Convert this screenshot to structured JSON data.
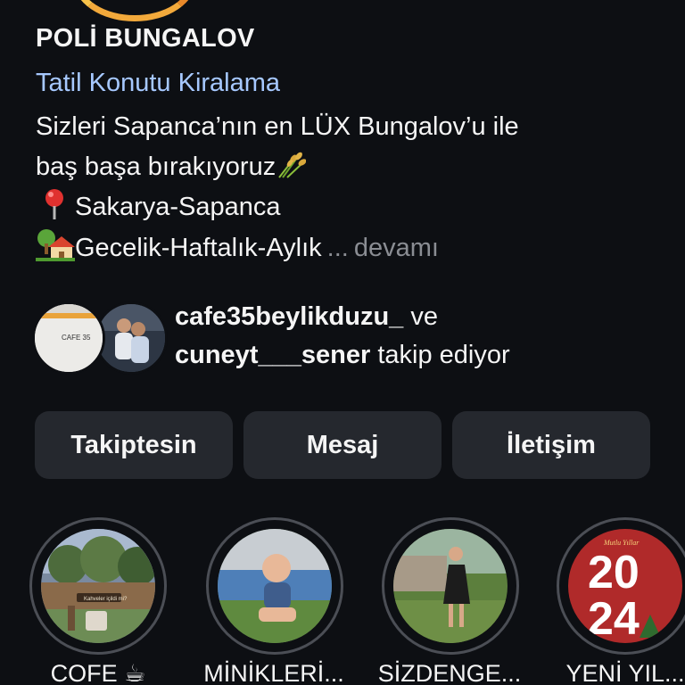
{
  "profile": {
    "name": "POLİ BUNGALOV",
    "category": "Tatil Konutu Kiralama",
    "bio": {
      "line1": "Sizleri Sapanca’nın en LÜX Bungalov’u ile",
      "line2": "baş başa bırakıyoruz",
      "line2_emoji": "sheaf-of-rice-icon",
      "line3": "Sakarya-Sapanca",
      "line3_emoji": "round-pushpin-icon",
      "line4": "Gecelik-Haftalık-Aylık",
      "line4_emoji": "house-with-garden-icon",
      "ellipsis": "...",
      "more": "devamı"
    }
  },
  "followed_by": {
    "user1": "cafe35beylikduzu_",
    "conjunction": "ve",
    "user2": "cuneyt___sener",
    "suffix": "takip ediyor",
    "avatar1_text": "CAFE 35"
  },
  "actions": {
    "follow": "Takiptesin",
    "message": "Mesaj",
    "contact": "İletişim"
  },
  "highlights": [
    {
      "label": "COFE ☕"
    },
    {
      "label": "MİNİKLERİ..."
    },
    {
      "label": "SİZDENGE..."
    },
    {
      "label": "YENİ YIL..."
    }
  ],
  "highlight_art": {
    "cofe_caption": "Kahveler içildi mi?",
    "new_year_top": "Mutlu Yıllar",
    "new_year_digits_top": "20",
    "new_year_digits_bottom": "24"
  },
  "colors": {
    "background": "#0d0f13",
    "button_bg": "#25282e",
    "category_link": "#a6c8ff",
    "muted": "#8a8d93",
    "ring": "#4b4e55",
    "story_ring": "#f2a93b"
  }
}
